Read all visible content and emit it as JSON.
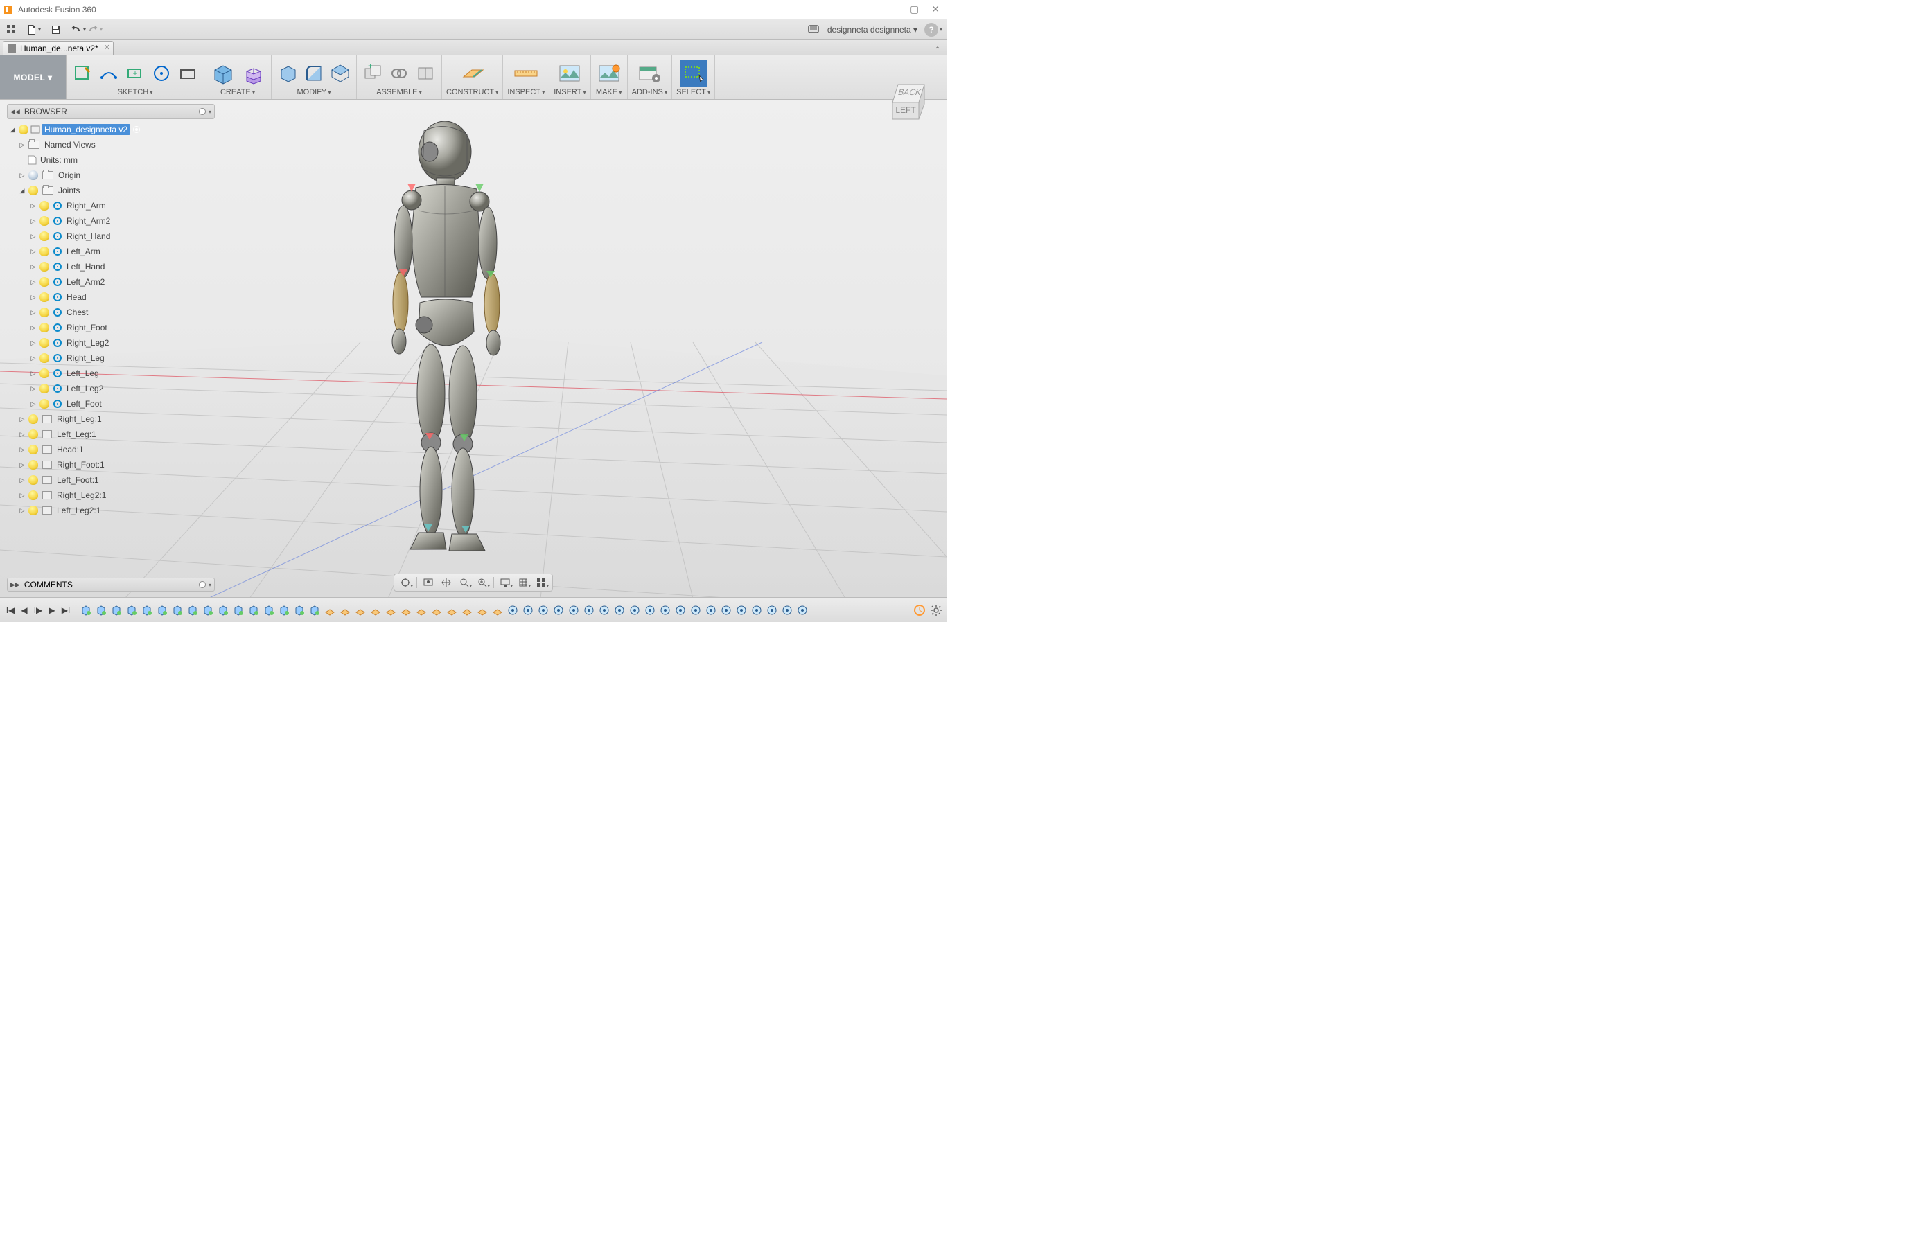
{
  "app_title": "Autodesk Fusion 360",
  "account_label": "designneta designneta ▾",
  "tab": {
    "label": "Human_de...neta v2*"
  },
  "workspace_button": "MODEL ▾",
  "ribbon_groups": [
    "SKETCH",
    "CREATE",
    "MODIFY",
    "ASSEMBLE",
    "CONSTRUCT",
    "INSPECT",
    "INSERT",
    "MAKE",
    "ADD-INS",
    "SELECT"
  ],
  "viewcube": {
    "front": "LEFT",
    "side": "BACK"
  },
  "browser": {
    "title": "BROWSER",
    "root": "Human_designneta v2",
    "named_views": "Named Views",
    "units": "Units: mm",
    "origin": "Origin",
    "joints_label": "Joints",
    "joints": [
      "Right_Arm",
      "Right_Arm2",
      "Right_Hand",
      "Left_Arm",
      "Left_Hand",
      "Left_Arm2",
      "Head",
      "Chest",
      "Right_Foot",
      "Right_Leg2",
      "Right_Leg",
      "Left_Leg",
      "Left_Leg2",
      "Left_Foot"
    ],
    "components": [
      "Right_Leg:1",
      "Left_Leg:1",
      "Head:1",
      "Right_Foot:1",
      "Left_Foot:1",
      "Right_Leg2:1",
      "Left_Leg2:1"
    ]
  },
  "comments_label": "COMMENTS",
  "timeline_feature_count": 48
}
